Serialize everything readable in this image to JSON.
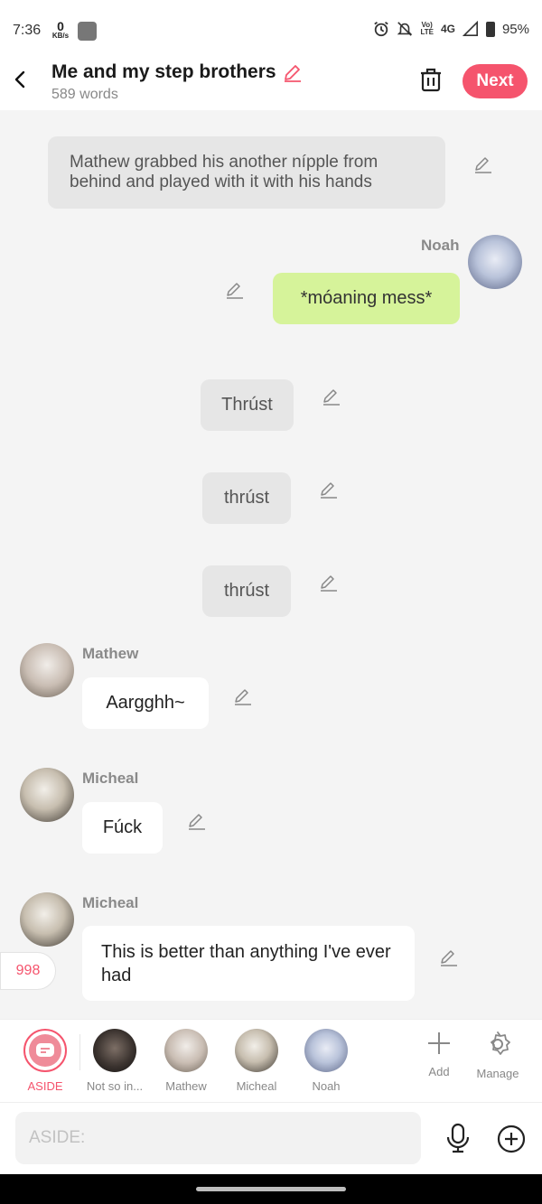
{
  "status_bar": {
    "time": "7:36",
    "net_speed": "0",
    "net_unit": "KB/s",
    "volte_top": "Vo)",
    "volte_bottom": "LTE",
    "network": "4G",
    "battery": "95%"
  },
  "header": {
    "title": "Me and my step brothers",
    "word_count": "589 words",
    "next_label": "Next"
  },
  "chat": {
    "narration_1": "Mathew grabbed his another nípple from behind and played with it with his hands",
    "noah_name": "Noah",
    "noah_message": "*móaning mess*",
    "narration_2": "Thrúst",
    "narration_3": "thrúst",
    "narration_4": "thrúst",
    "mathew_name": "Mathew",
    "mathew_message": "Aargghh~",
    "micheal_name_1": "Micheal",
    "micheal_message_1": "Fúck",
    "micheal_name_2": "Micheal",
    "micheal_message_2": "This is better than anything I've ever had",
    "count": "998"
  },
  "characters": [
    {
      "label": "ASIDE"
    },
    {
      "label": "Not so in..."
    },
    {
      "label": "Mathew"
    },
    {
      "label": "Micheal"
    },
    {
      "label": "Noah"
    }
  ],
  "tools": {
    "add_label": "Add",
    "manage_label": "Manage"
  },
  "input": {
    "placeholder": "ASIDE:"
  },
  "colors": {
    "accent": "#f5546d",
    "user_bubble": "#d6f39a",
    "narration_bubble": "#e6e6e6"
  }
}
